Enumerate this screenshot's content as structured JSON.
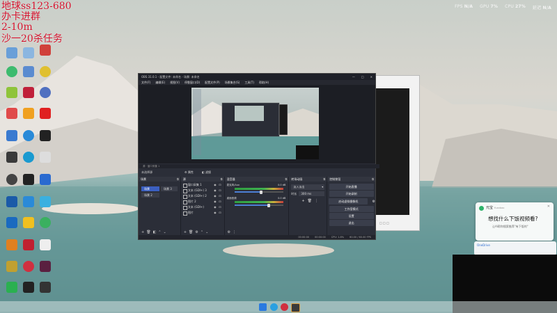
{
  "overlay": {
    "line1": "地球ss123-680",
    "line2": "办卡进群",
    "line3": "2-10m",
    "line4": "沙一20杀任务"
  },
  "perf": {
    "fps_label": "FPS",
    "fps_value": "N/A",
    "gpu_label": "GPU",
    "gpu_value": "7%",
    "cpu_label": "CPU",
    "cpu_value": "27%",
    "latency_label": "延迟",
    "latency_value": "N/A"
  },
  "obs": {
    "title": "OBS 31.0.1 - 配置文件: 未命名 - 场景: 未命名",
    "menu": [
      "文件(F)",
      "编辑(E)",
      "视图(V)",
      "停靠窗口(D)",
      "配置文件(P)",
      "场景集合(S)",
      "工具(T)",
      "帮助(H)"
    ],
    "status_row": "源 · 窗口采集 1",
    "source_label": "未选择源",
    "properties_button": "属性",
    "filters_button": "滤镜",
    "scenes": {
      "title": "场景",
      "items": [
        "场景",
        "场景 3",
        "场景 2"
      ]
    },
    "sources": {
      "title": "源",
      "items": [
        "窗口采集 1",
        "文本 (GDI+) 3",
        "文本 (GDI+) 2",
        "图片 2",
        "文本 (GDI+)",
        "图片"
      ]
    },
    "mixer": {
      "title": "混音器",
      "channels": [
        {
          "name": "麦克风/Aux",
          "db": "0.0 dB",
          "level": 0.55
        },
        {
          "name": "桌面音频",
          "db": "0.0 dB",
          "level": 0.7
        }
      ]
    },
    "transitions": {
      "title": "转场动画",
      "type": "淡入淡出",
      "duration_label": "时长",
      "duration": "300 ms"
    },
    "controls": {
      "title": "控制按钮",
      "buttons": [
        "开始直播",
        "开始录制",
        "启动虚拟摄像机",
        "工作室模式",
        "设置",
        "退出"
      ]
    },
    "statusbar": {
      "stream_time": "00:00:00",
      "record_time": "00:00:00",
      "cpu": "CPU: 1.8%",
      "fps": "60.00 / 60.00 FPS"
    }
  },
  "popup": {
    "app": "元宝",
    "app_sub": "Yuanbao",
    "headline": "想找什么下饭视频看?",
    "body": "让AI帮你搜索推荐\"有下饭的\"",
    "second_app": "OneDrive"
  },
  "colors": {
    "obs_bg": "#2b2e38",
    "scene_selected": "#3b5fc0",
    "overlay_text": "#d0102a"
  }
}
